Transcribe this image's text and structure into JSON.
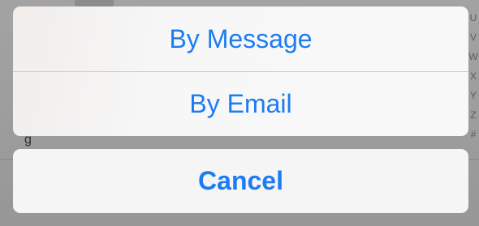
{
  "action_sheet": {
    "options": [
      {
        "label": "By Message"
      },
      {
        "label": "By Email"
      }
    ],
    "cancel_label": "Cancel"
  },
  "background": {
    "index_letters": [
      "U",
      "V",
      "W",
      "X",
      "Y",
      "Z",
      "#"
    ],
    "partial_glyph": "g"
  },
  "colors": {
    "accent": "#1b7cf3",
    "sheet_background": "#f5f5f5",
    "dimmed_background": "#9b9b9b"
  }
}
